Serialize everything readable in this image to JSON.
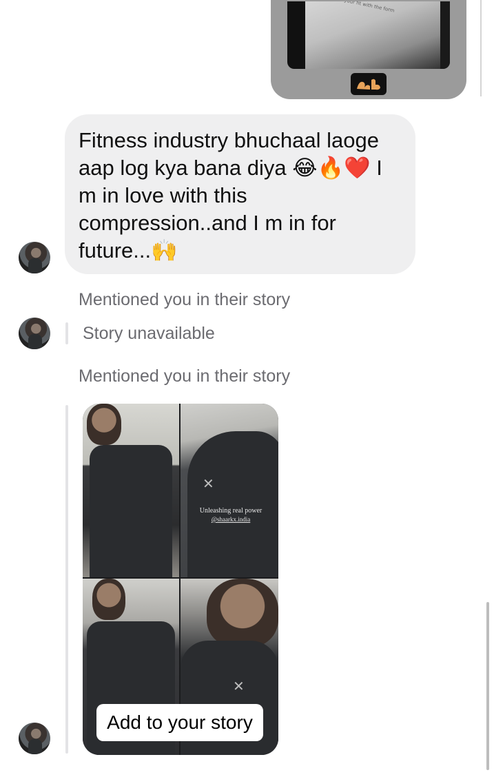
{
  "sent_story": {
    "reaction_icon": "flexed-arm-emoji",
    "scribble_text": "tries your fit with the form"
  },
  "message": {
    "text": "Fitness industry bhuchaal laoge\naap log kya bana diya 😂🔥❤️ I\nm in love with this\ncompression..and I m in for\nfuture...🙌"
  },
  "mention_1": {
    "label": "Mentioned you in their story",
    "status": "Story unavailable"
  },
  "mention_2": {
    "label": "Mentioned you in their story",
    "caption": "Unleashing real power",
    "handle": "@shaarkx.india",
    "add_button": "Add to your story"
  },
  "colors": {
    "bubble_bg": "#efeff0",
    "meta_text": "#6b6b70",
    "sent_bubble": "#9b9b9b"
  }
}
